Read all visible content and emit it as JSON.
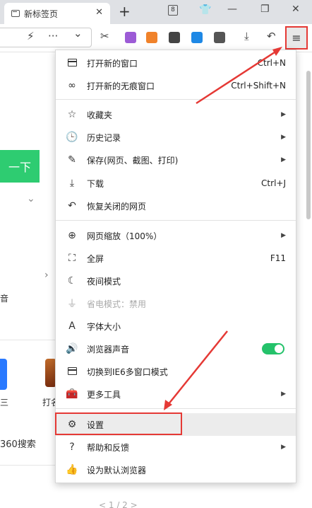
{
  "tab": {
    "title": "新标签页",
    "close": "✕"
  },
  "tabbar": {
    "new_tab": "+",
    "tab_count": "8",
    "shirt": "👕",
    "minimize": "—",
    "restore": "❐",
    "close": "✕"
  },
  "toolbar": {
    "bolt": "⚡",
    "more": "···",
    "chevron": "⌄",
    "scissors": "✂",
    "download": "⤓",
    "undo": "↶",
    "menu": "≡"
  },
  "background_page": {
    "button_text": "一下",
    "chevron": "⌄",
    "arrow": "›",
    "text_a": "音",
    "text_b": "三",
    "text_c": "打名",
    "search_text": "360搜索",
    "pager": "< 1 / 2 >"
  },
  "menu": {
    "items": [
      {
        "icon": "window-icon",
        "label": "打开新的窗口",
        "shortcut": "Ctrl+N"
      },
      {
        "icon": "incognito-icon",
        "label": "打开新的无痕窗口",
        "shortcut": "Ctrl+Shift+N"
      },
      {
        "icon": "star-list-icon",
        "label": "收藏夹",
        "arrow": "▶"
      },
      {
        "icon": "clock-icon",
        "label": "历史记录",
        "arrow": "▶"
      },
      {
        "icon": "save-icon",
        "label": "保存(网页、截图、打印)",
        "arrow": "▶"
      },
      {
        "icon": "download-icon",
        "label": "下载",
        "shortcut": "Ctrl+J"
      },
      {
        "icon": "restore-icon",
        "label": "恢复关闭的网页"
      },
      {
        "icon": "zoom-icon",
        "label": "网页缩放（100%）",
        "arrow": "▶"
      },
      {
        "icon": "fullscreen-icon",
        "label": "全屏",
        "shortcut": "F11"
      },
      {
        "icon": "moon-icon",
        "label": "夜间模式"
      },
      {
        "icon": "plug-icon",
        "label": "省电模式：禁用"
      },
      {
        "icon": "font-icon",
        "label": "字体大小"
      },
      {
        "icon": "speaker-icon",
        "label": "浏览器声音",
        "toggle": true
      },
      {
        "icon": "ie-window-icon",
        "label": "切换到IE6多窗口模式"
      },
      {
        "icon": "toolbox-icon",
        "label": "更多工具",
        "arrow": "▶"
      },
      {
        "icon": "gear-icon",
        "label": "设置"
      },
      {
        "icon": "help-icon",
        "label": "帮助和反馈",
        "arrow": "▶"
      },
      {
        "icon": "thumb-icon",
        "label": "设为默认浏览器"
      }
    ]
  },
  "colors": {
    "highlight": "#e53935",
    "toggle_on": "#24c26a",
    "green_button": "#2ecc71"
  }
}
